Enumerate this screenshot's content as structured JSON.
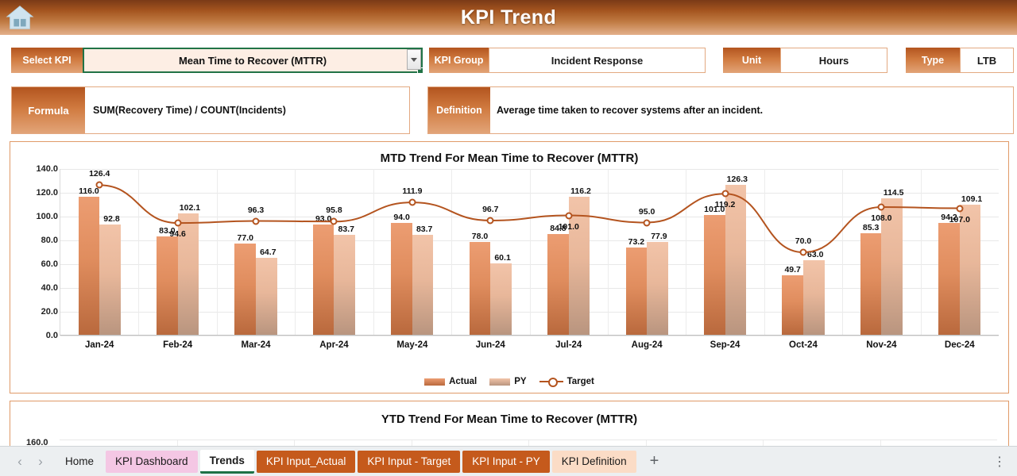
{
  "header": {
    "title": "KPI Trend",
    "home_icon": "home-icon"
  },
  "selectors": {
    "select_kpi_label": "Select KPI",
    "select_kpi_value": "Mean Time to Recover (MTTR)",
    "kpi_group_label": "KPI Group",
    "kpi_group_value": "Incident Response",
    "unit_label": "Unit",
    "unit_value": "Hours",
    "type_label": "Type",
    "type_value": "LTB"
  },
  "info": {
    "formula_label": "Formula",
    "formula_value": "SUM(Recovery Time) / COUNT(Incidents)",
    "definition_label": "Definition",
    "definition_value": "Average time taken to recover systems after an incident."
  },
  "ytd": {
    "title": "YTD Trend For Mean Time to Recover (MTTR)",
    "first_tick": "160.0"
  },
  "legend": {
    "actual": "Actual",
    "py": "PY",
    "target": "Target"
  },
  "tabs": [
    {
      "label": "Home",
      "style": "plain"
    },
    {
      "label": "KPI Dashboard",
      "style": "pink"
    },
    {
      "label": "Trends",
      "style": "active"
    },
    {
      "label": "KPI Input_Actual",
      "style": "orange"
    },
    {
      "label": "KPI Input - Target",
      "style": "orange"
    },
    {
      "label": "KPI Input - PY",
      "style": "orange"
    },
    {
      "label": "KPI Definition",
      "style": "peach"
    }
  ],
  "tabbar": {
    "add": "+",
    "prev": "‹",
    "next": "›",
    "menu": "⋮"
  },
  "colors": {
    "accent": "#c55a1c",
    "actual_bar": "#e08d5e",
    "py_bar": "#e8b79a",
    "target_line": "#b4541f",
    "header_gradient_start": "#7a3a17",
    "header_gradient_end": "#e3b08a"
  },
  "chart_data": {
    "type": "bar",
    "title": "MTD Trend For Mean Time to Recover (MTTR)",
    "xlabel": "",
    "ylabel": "",
    "ylim": [
      0,
      140
    ],
    "yticks": [
      0,
      20,
      40,
      60,
      80,
      100,
      120,
      140
    ],
    "ytick_labels": [
      "0.0",
      "20.0",
      "40.0",
      "60.0",
      "80.0",
      "100.0",
      "120.0",
      "140.0"
    ],
    "grid": true,
    "legend_position": "bottom",
    "categories": [
      "Jan-24",
      "Feb-24",
      "Mar-24",
      "Apr-24",
      "May-24",
      "Jun-24",
      "Jul-24",
      "Aug-24",
      "Sep-24",
      "Oct-24",
      "Nov-24",
      "Dec-24"
    ],
    "series": [
      {
        "name": "Actual",
        "type": "bar",
        "values": [
          116.0,
          83.0,
          77.0,
          93.0,
          94.0,
          78.0,
          84.8,
          73.2,
          101.0,
          49.7,
          85.3,
          94.2
        ]
      },
      {
        "name": "PY",
        "type": "bar",
        "values": [
          92.8,
          102.1,
          64.7,
          83.7,
          83.7,
          60.1,
          116.2,
          77.9,
          126.3,
          63.0,
          114.5,
          109.1
        ]
      },
      {
        "name": "Target",
        "type": "line",
        "values": [
          126.4,
          94.6,
          96.3,
          95.8,
          111.9,
          96.7,
          101.0,
          95.0,
          119.2,
          70.0,
          108.0,
          107.0
        ]
      }
    ]
  }
}
